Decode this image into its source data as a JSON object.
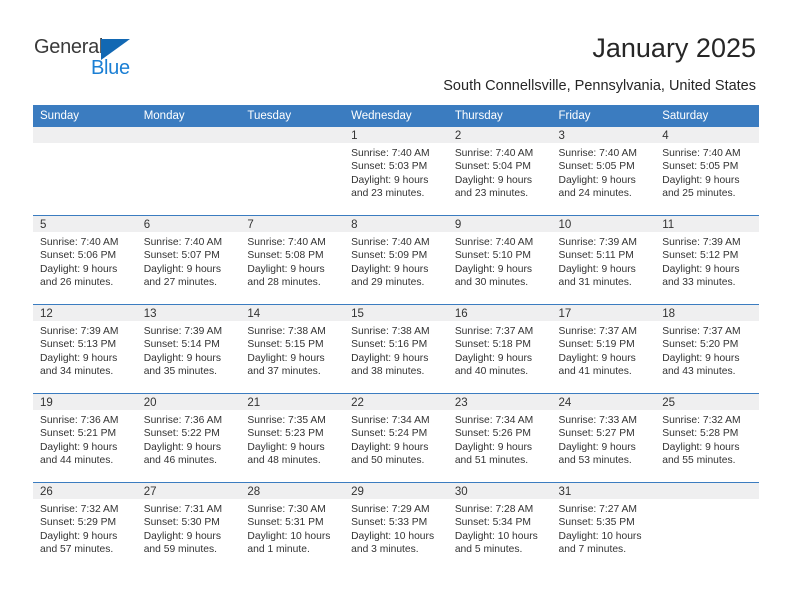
{
  "brand": {
    "name_part1": "General",
    "name_part2": "Blue",
    "primary_color": "#1b7fd4",
    "triangle_color": "#1268b3"
  },
  "header": {
    "title": "January 2025",
    "subtitle": "South Connellsville, Pennsylvania, United States"
  },
  "calendar": {
    "header_bg": "#3b7cc0",
    "daynum_bg": "#efeff0",
    "columns": [
      "Sunday",
      "Monday",
      "Tuesday",
      "Wednesday",
      "Thursday",
      "Friday",
      "Saturday"
    ],
    "labels": {
      "sunrise": "Sunrise:",
      "sunset": "Sunset:",
      "daylight": "Daylight:"
    },
    "weeks": [
      [
        {
          "day": ""
        },
        {
          "day": ""
        },
        {
          "day": ""
        },
        {
          "day": "1",
          "sunrise": "Sunrise: 7:40 AM",
          "sunset": "Sunset: 5:03 PM",
          "daylight_line1": "Daylight: 9 hours",
          "daylight_line2": "and 23 minutes."
        },
        {
          "day": "2",
          "sunrise": "Sunrise: 7:40 AM",
          "sunset": "Sunset: 5:04 PM",
          "daylight_line1": "Daylight: 9 hours",
          "daylight_line2": "and 23 minutes."
        },
        {
          "day": "3",
          "sunrise": "Sunrise: 7:40 AM",
          "sunset": "Sunset: 5:05 PM",
          "daylight_line1": "Daylight: 9 hours",
          "daylight_line2": "and 24 minutes."
        },
        {
          "day": "4",
          "sunrise": "Sunrise: 7:40 AM",
          "sunset": "Sunset: 5:05 PM",
          "daylight_line1": "Daylight: 9 hours",
          "daylight_line2": "and 25 minutes."
        }
      ],
      [
        {
          "day": "5",
          "sunrise": "Sunrise: 7:40 AM",
          "sunset": "Sunset: 5:06 PM",
          "daylight_line1": "Daylight: 9 hours",
          "daylight_line2": "and 26 minutes."
        },
        {
          "day": "6",
          "sunrise": "Sunrise: 7:40 AM",
          "sunset": "Sunset: 5:07 PM",
          "daylight_line1": "Daylight: 9 hours",
          "daylight_line2": "and 27 minutes."
        },
        {
          "day": "7",
          "sunrise": "Sunrise: 7:40 AM",
          "sunset": "Sunset: 5:08 PM",
          "daylight_line1": "Daylight: 9 hours",
          "daylight_line2": "and 28 minutes."
        },
        {
          "day": "8",
          "sunrise": "Sunrise: 7:40 AM",
          "sunset": "Sunset: 5:09 PM",
          "daylight_line1": "Daylight: 9 hours",
          "daylight_line2": "and 29 minutes."
        },
        {
          "day": "9",
          "sunrise": "Sunrise: 7:40 AM",
          "sunset": "Sunset: 5:10 PM",
          "daylight_line1": "Daylight: 9 hours",
          "daylight_line2": "and 30 minutes."
        },
        {
          "day": "10",
          "sunrise": "Sunrise: 7:39 AM",
          "sunset": "Sunset: 5:11 PM",
          "daylight_line1": "Daylight: 9 hours",
          "daylight_line2": "and 31 minutes."
        },
        {
          "day": "11",
          "sunrise": "Sunrise: 7:39 AM",
          "sunset": "Sunset: 5:12 PM",
          "daylight_line1": "Daylight: 9 hours",
          "daylight_line2": "and 33 minutes."
        }
      ],
      [
        {
          "day": "12",
          "sunrise": "Sunrise: 7:39 AM",
          "sunset": "Sunset: 5:13 PM",
          "daylight_line1": "Daylight: 9 hours",
          "daylight_line2": "and 34 minutes."
        },
        {
          "day": "13",
          "sunrise": "Sunrise: 7:39 AM",
          "sunset": "Sunset: 5:14 PM",
          "daylight_line1": "Daylight: 9 hours",
          "daylight_line2": "and 35 minutes."
        },
        {
          "day": "14",
          "sunrise": "Sunrise: 7:38 AM",
          "sunset": "Sunset: 5:15 PM",
          "daylight_line1": "Daylight: 9 hours",
          "daylight_line2": "and 37 minutes."
        },
        {
          "day": "15",
          "sunrise": "Sunrise: 7:38 AM",
          "sunset": "Sunset: 5:16 PM",
          "daylight_line1": "Daylight: 9 hours",
          "daylight_line2": "and 38 minutes."
        },
        {
          "day": "16",
          "sunrise": "Sunrise: 7:37 AM",
          "sunset": "Sunset: 5:18 PM",
          "daylight_line1": "Daylight: 9 hours",
          "daylight_line2": "and 40 minutes."
        },
        {
          "day": "17",
          "sunrise": "Sunrise: 7:37 AM",
          "sunset": "Sunset: 5:19 PM",
          "daylight_line1": "Daylight: 9 hours",
          "daylight_line2": "and 41 minutes."
        },
        {
          "day": "18",
          "sunrise": "Sunrise: 7:37 AM",
          "sunset": "Sunset: 5:20 PM",
          "daylight_line1": "Daylight: 9 hours",
          "daylight_line2": "and 43 minutes."
        }
      ],
      [
        {
          "day": "19",
          "sunrise": "Sunrise: 7:36 AM",
          "sunset": "Sunset: 5:21 PM",
          "daylight_line1": "Daylight: 9 hours",
          "daylight_line2": "and 44 minutes."
        },
        {
          "day": "20",
          "sunrise": "Sunrise: 7:36 AM",
          "sunset": "Sunset: 5:22 PM",
          "daylight_line1": "Daylight: 9 hours",
          "daylight_line2": "and 46 minutes."
        },
        {
          "day": "21",
          "sunrise": "Sunrise: 7:35 AM",
          "sunset": "Sunset: 5:23 PM",
          "daylight_line1": "Daylight: 9 hours",
          "daylight_line2": "and 48 minutes."
        },
        {
          "day": "22",
          "sunrise": "Sunrise: 7:34 AM",
          "sunset": "Sunset: 5:24 PM",
          "daylight_line1": "Daylight: 9 hours",
          "daylight_line2": "and 50 minutes."
        },
        {
          "day": "23",
          "sunrise": "Sunrise: 7:34 AM",
          "sunset": "Sunset: 5:26 PM",
          "daylight_line1": "Daylight: 9 hours",
          "daylight_line2": "and 51 minutes."
        },
        {
          "day": "24",
          "sunrise": "Sunrise: 7:33 AM",
          "sunset": "Sunset: 5:27 PM",
          "daylight_line1": "Daylight: 9 hours",
          "daylight_line2": "and 53 minutes."
        },
        {
          "day": "25",
          "sunrise": "Sunrise: 7:32 AM",
          "sunset": "Sunset: 5:28 PM",
          "daylight_line1": "Daylight: 9 hours",
          "daylight_line2": "and 55 minutes."
        }
      ],
      [
        {
          "day": "26",
          "sunrise": "Sunrise: 7:32 AM",
          "sunset": "Sunset: 5:29 PM",
          "daylight_line1": "Daylight: 9 hours",
          "daylight_line2": "and 57 minutes."
        },
        {
          "day": "27",
          "sunrise": "Sunrise: 7:31 AM",
          "sunset": "Sunset: 5:30 PM",
          "daylight_line1": "Daylight: 9 hours",
          "daylight_line2": "and 59 minutes."
        },
        {
          "day": "28",
          "sunrise": "Sunrise: 7:30 AM",
          "sunset": "Sunset: 5:31 PM",
          "daylight_line1": "Daylight: 10 hours",
          "daylight_line2": "and 1 minute."
        },
        {
          "day": "29",
          "sunrise": "Sunrise: 7:29 AM",
          "sunset": "Sunset: 5:33 PM",
          "daylight_line1": "Daylight: 10 hours",
          "daylight_line2": "and 3 minutes."
        },
        {
          "day": "30",
          "sunrise": "Sunrise: 7:28 AM",
          "sunset": "Sunset: 5:34 PM",
          "daylight_line1": "Daylight: 10 hours",
          "daylight_line2": "and 5 minutes."
        },
        {
          "day": "31",
          "sunrise": "Sunrise: 7:27 AM",
          "sunset": "Sunset: 5:35 PM",
          "daylight_line1": "Daylight: 10 hours",
          "daylight_line2": "and 7 minutes."
        },
        {
          "day": ""
        }
      ]
    ]
  }
}
